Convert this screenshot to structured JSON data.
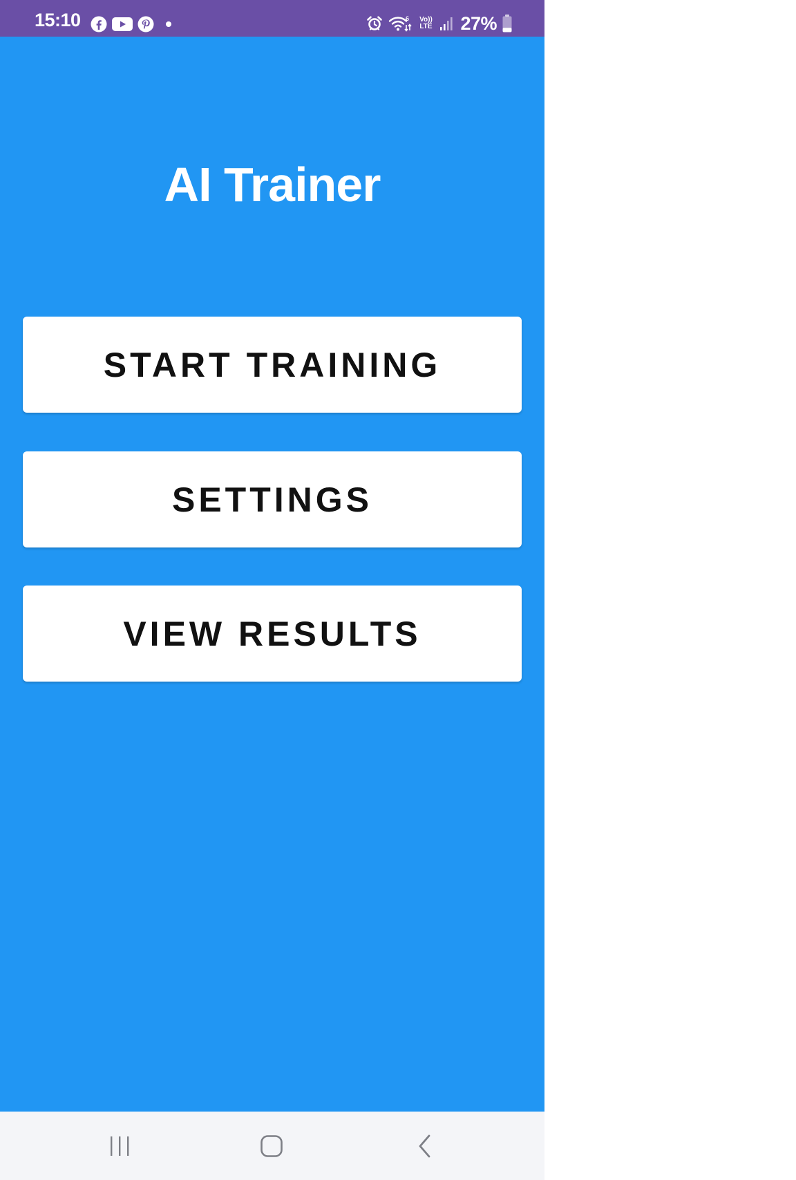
{
  "status_bar": {
    "time": "15:10",
    "left_icons": [
      "facebook-icon",
      "youtube-icon",
      "pinterest-icon",
      "notification-dot"
    ],
    "right_icons": [
      "alarm-icon",
      "wifi-6-icon",
      "volte-icon",
      "signal-icon",
      "battery-icon"
    ],
    "volte_label_top": "Vo))",
    "volte_label_bottom": "LTE",
    "battery_percent": "27%",
    "battery_level": 0.27,
    "color": "#6a4fa6"
  },
  "app": {
    "title": "AI Trainer",
    "background_color": "#2196f3",
    "buttons": [
      {
        "label": "START TRAINING"
      },
      {
        "label": "SETTINGS"
      },
      {
        "label": "VIEW RESULTS"
      }
    ]
  },
  "nav_bar": {
    "items": [
      "recents-icon",
      "home-icon",
      "back-icon"
    ]
  }
}
